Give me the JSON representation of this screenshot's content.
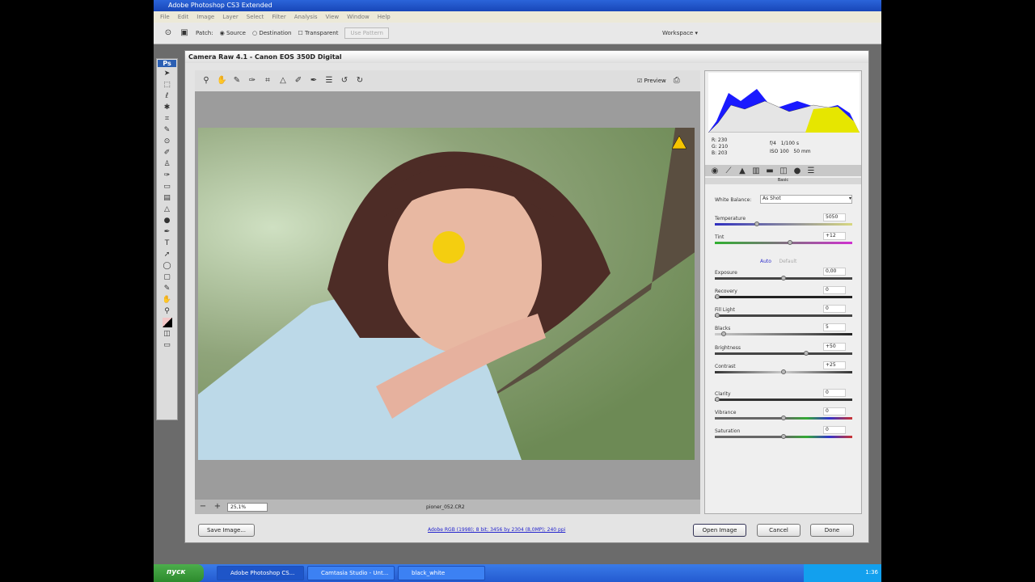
{
  "app": {
    "title": "Adobe Photoshop CS3 Extended",
    "menu": [
      "File",
      "Edit",
      "Image",
      "Layer",
      "Select",
      "Filter",
      "Analysis",
      "View",
      "Window",
      "Help"
    ]
  },
  "options": {
    "patch_label": "Patch:",
    "source": "Source",
    "destination": "Destination",
    "transparent": "Transparent",
    "use_pattern": "Use Pattern",
    "workspace": "Workspace ▾"
  },
  "toolbox": {
    "logo": "Ps"
  },
  "dialog": {
    "title": "Camera Raw 4.1  -  Canon EOS 350D Digital",
    "preview_label": "Preview",
    "zoom": "25,1%",
    "filename": "pioner_052.CR2",
    "readout": {
      "r": "R: 230",
      "g": "G: 210",
      "b": "B: 203",
      "aperture": "f/4",
      "shutter": "1/100 s",
      "iso_focal": "ISO 100",
      "focal": "50 mm"
    },
    "section": "Basic",
    "white_balance": {
      "label": "White Balance:",
      "value": "As Shot"
    },
    "temperature": {
      "label": "Temperature",
      "value": "5050",
      "pos": 0.3
    },
    "tint": {
      "label": "Tint",
      "value": "+12",
      "pos": 0.55
    },
    "auto": "Auto",
    "default": "Default",
    "sliders": [
      {
        "label": "Exposure",
        "value": "0,00",
        "pos": 0.5
      },
      {
        "label": "Recovery",
        "value": "0",
        "pos": 0
      },
      {
        "label": "Fill Light",
        "value": "0",
        "pos": 0
      },
      {
        "label": "Blacks",
        "value": "5",
        "pos": 0.05
      },
      {
        "label": "Brightness",
        "value": "+50",
        "pos": 0.67
      },
      {
        "label": "Contrast",
        "value": "+25",
        "pos": 0.5
      },
      {
        "label": "Clarity",
        "value": "0",
        "pos": 0
      },
      {
        "label": "Vibrance",
        "value": "0",
        "pos": 0.5
      },
      {
        "label": "Saturation",
        "value": "0",
        "pos": 0.5
      }
    ],
    "save": "Save Image...",
    "workflow_link": "Adobe RGB (1998); 8 bit; 3456 by 2304 (8,0MP); 240 ppi",
    "open": "Open Image",
    "cancel": "Cancel",
    "done": "Done"
  },
  "taskbar": {
    "start": "пуск",
    "tasks": [
      "Adobe Photoshop CS...",
      "Camtasia Studio - Unt...",
      "black_white"
    ],
    "clock": "1:36"
  }
}
